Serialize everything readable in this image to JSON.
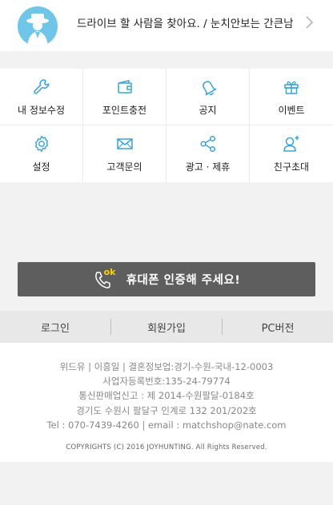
{
  "profile": {
    "text": "드라이브 할 사람을 찾아요. / 눈치안보는 간큰남"
  },
  "menu": {
    "items": [
      {
        "label": "내 정보수정",
        "icon": "wrench-icon"
      },
      {
        "label": "포인트충전",
        "icon": "wallet-icon"
      },
      {
        "label": "공지",
        "icon": "bell-icon"
      },
      {
        "label": "이벤트",
        "icon": "gift-icon"
      },
      {
        "label": "설정",
        "icon": "gear-icon"
      },
      {
        "label": "고객문의",
        "icon": "envelope-icon"
      },
      {
        "label": "광고 · 제휴",
        "icon": "share-icon"
      },
      {
        "label": "친구초대",
        "icon": "add-friend-icon"
      }
    ]
  },
  "verify": {
    "badge": "ok",
    "label": "휴대폰 인증해 주세요!"
  },
  "auth": {
    "login": "로그인",
    "signup": "회원가입",
    "pc": "PC버전"
  },
  "footer": {
    "lines": [
      "위드유 | 이흥일 | 결혼정보업:경기-수원-국내-12-0003",
      "사업자등록번호:135-24-79774",
      "통신판매업신고 : 제 2014-수원팔달-0184호",
      "경기도 수원시 팔달구 인계로 132 201/202호",
      "Tel : 070-7439-4260 | email : matchshop@nate.com"
    ],
    "copyright": "COPYRIGHTS (C) 2016 JOYHUNTING. All Rights Reserved."
  },
  "colors": {
    "icon_accent": "#3aa3d6",
    "verify_bg": "#5e5e5e",
    "verify_badge": "#ffd200",
    "avatar_bg": "#6fc6e8"
  }
}
